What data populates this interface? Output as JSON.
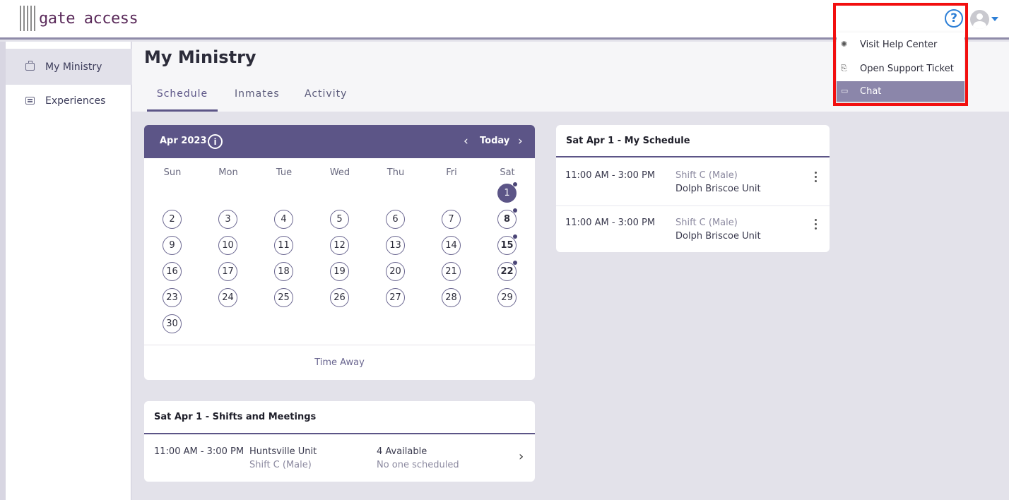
{
  "header": {
    "logo_text": "gate access",
    "help_icon": "question-circle-icon",
    "help_glyph": "?",
    "avatar_icon": "user-avatar-icon"
  },
  "sidebar": {
    "items": [
      {
        "label": "My Ministry",
        "icon": "briefcase-icon",
        "active": true
      },
      {
        "label": "Experiences",
        "icon": "newspaper-icon",
        "active": false
      }
    ]
  },
  "page": {
    "title": "My Ministry",
    "tabs": [
      {
        "label": "Schedule",
        "active": true
      },
      {
        "label": "Inmates",
        "active": false
      },
      {
        "label": "Activity",
        "active": false
      }
    ]
  },
  "calendar": {
    "month_label": "Apr 2023",
    "info_glyph": "i",
    "prev_glyph": "‹",
    "next_glyph": "›",
    "today_label": "Today",
    "weekdays": [
      "Sun",
      "Mon",
      "Tue",
      "Wed",
      "Thu",
      "Fri",
      "Sat"
    ],
    "days": [
      "1",
      "2",
      "3",
      "4",
      "5",
      "6",
      "7",
      "8",
      "9",
      "10",
      "11",
      "12",
      "13",
      "14",
      "15",
      "16",
      "17",
      "18",
      "19",
      "20",
      "21",
      "22",
      "23",
      "24",
      "25",
      "26",
      "27",
      "28",
      "29",
      "30"
    ],
    "selected_day": "1",
    "days_with_events": [
      "1",
      "8",
      "15",
      "22"
    ],
    "footer_label": "Time Away"
  },
  "shifts": {
    "title": "Sat Apr 1 - Shifts and Meetings",
    "rows": [
      {
        "time": "11:00 AM - 3:00 PM",
        "location": "Huntsville Unit",
        "shift": "Shift C (Male)",
        "availability": "4 Available",
        "scheduled": "No one scheduled"
      }
    ],
    "chevron_glyph": "›"
  },
  "my_schedule": {
    "title": "Sat Apr 1 - My Schedule",
    "rows": [
      {
        "time": "11:00 AM - 3:00 PM",
        "shift": "Shift C (Male)",
        "location": "Dolph Briscoe Unit"
      },
      {
        "time": "11:00 AM - 3:00 PM",
        "shift": "Shift C (Male)",
        "location": "Dolph Briscoe Unit"
      }
    ]
  },
  "help_menu": {
    "items": [
      {
        "label": "Visit Help Center",
        "icon": "lightbulb-icon",
        "glyph": "✺",
        "highlighted": false
      },
      {
        "label": "Open Support Ticket",
        "icon": "ticket-exit-icon",
        "glyph": "⎘",
        "highlighted": false
      },
      {
        "label": "Chat",
        "icon": "chat-bubbles-icon",
        "glyph": "▭",
        "highlighted": true
      }
    ]
  },
  "colors": {
    "accent": "#5c5587",
    "help_blue": "#2d7fd6",
    "highlight_box": "#f20f0f"
  }
}
